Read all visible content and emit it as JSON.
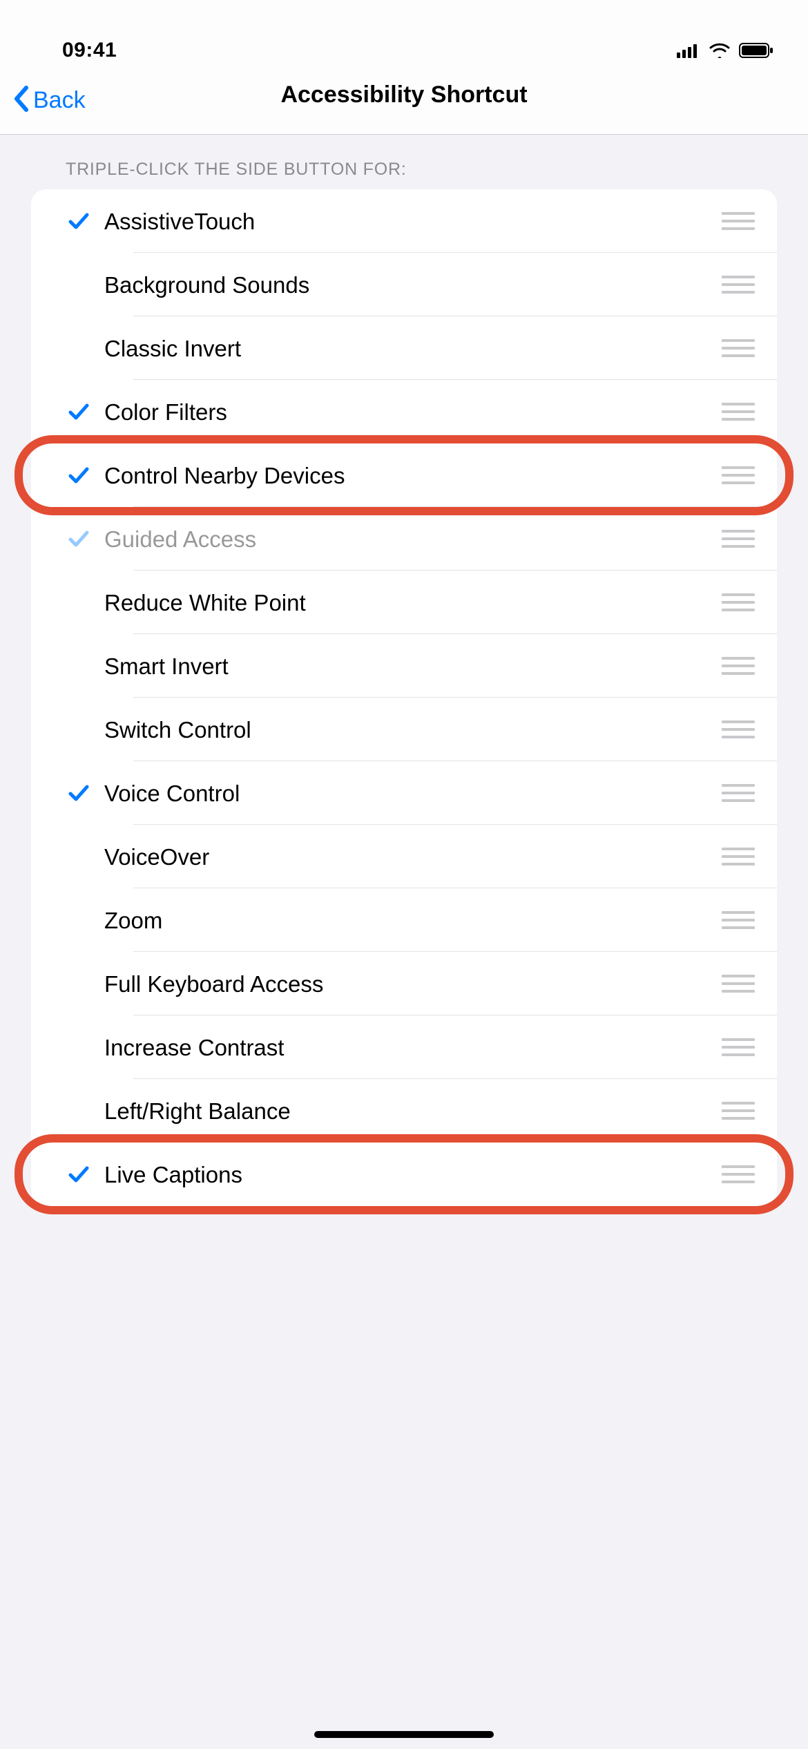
{
  "statusBar": {
    "time": "09:41"
  },
  "nav": {
    "backLabel": "Back",
    "title": "Accessibility Shortcut"
  },
  "section": {
    "header": "Triple-click the side button for:"
  },
  "items": [
    {
      "label": "AssistiveTouch",
      "checked": true,
      "dim": false,
      "highlighted": false
    },
    {
      "label": "Background Sounds",
      "checked": false,
      "dim": false,
      "highlighted": false
    },
    {
      "label": "Classic Invert",
      "checked": false,
      "dim": false,
      "highlighted": false
    },
    {
      "label": "Color Filters",
      "checked": true,
      "dim": false,
      "highlighted": false
    },
    {
      "label": "Control Nearby Devices",
      "checked": true,
      "dim": false,
      "highlighted": true
    },
    {
      "label": "Guided Access",
      "checked": true,
      "dim": true,
      "highlighted": false
    },
    {
      "label": "Reduce White Point",
      "checked": false,
      "dim": false,
      "highlighted": false
    },
    {
      "label": "Smart Invert",
      "checked": false,
      "dim": false,
      "highlighted": false
    },
    {
      "label": "Switch Control",
      "checked": false,
      "dim": false,
      "highlighted": false
    },
    {
      "label": "Voice Control",
      "checked": true,
      "dim": false,
      "highlighted": false
    },
    {
      "label": "VoiceOver",
      "checked": false,
      "dim": false,
      "highlighted": false
    },
    {
      "label": "Zoom",
      "checked": false,
      "dim": false,
      "highlighted": false
    },
    {
      "label": "Full Keyboard Access",
      "checked": false,
      "dim": false,
      "highlighted": false
    },
    {
      "label": "Increase Contrast",
      "checked": false,
      "dim": false,
      "highlighted": false
    },
    {
      "label": "Left/Right Balance",
      "checked": false,
      "dim": false,
      "highlighted": false
    },
    {
      "label": "Live Captions",
      "checked": true,
      "dim": false,
      "highlighted": true
    }
  ]
}
